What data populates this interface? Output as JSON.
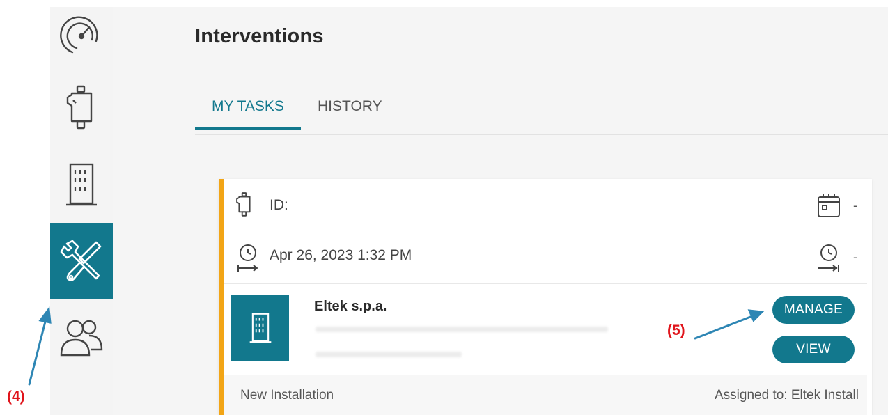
{
  "page": {
    "title": "Interventions"
  },
  "sidebar": {
    "items": [
      {
        "name": "dashboard",
        "icon": "gauge-icon",
        "active": false
      },
      {
        "name": "devices",
        "icon": "device-icon",
        "active": false
      },
      {
        "name": "buildings",
        "icon": "building-icon",
        "active": false
      },
      {
        "name": "interventions",
        "icon": "tools-icon",
        "active": true
      },
      {
        "name": "users",
        "icon": "users-icon",
        "active": false
      }
    ]
  },
  "tabs": [
    {
      "label": "MY TASKS",
      "active": true
    },
    {
      "label": "HISTORY",
      "active": false
    }
  ],
  "task": {
    "id_label": "ID:",
    "datetime": "Apr 26, 2023 1:32 PM",
    "scheduled_value": "-",
    "end_value": "-",
    "company_name": "Eltek s.p.a.",
    "manage_label": "MANAGE",
    "view_label": "VIEW",
    "type": "New Installation",
    "assigned": "Assigned to: Eltek Install"
  },
  "annotations": {
    "sidebar_marker": "(4)",
    "manage_marker": "(5)"
  },
  "colors": {
    "accent": "#12788d",
    "card_border": "#f2a516",
    "annotation": "#e0141b",
    "arrow": "#2e86b4"
  }
}
